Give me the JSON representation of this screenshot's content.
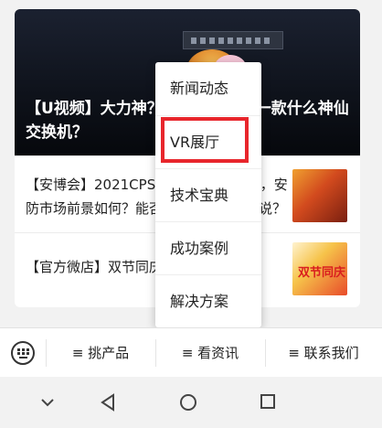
{
  "hero": {
    "title": "【U视频】大力神？小黄鸭？这是一款什么神仙交换机？"
  },
  "news": [
    {
      "text": "【安博会】2021CPSE安博会重磅开展，安防市场前景如何？能否迎来新机遇呢？说？",
      "thumb_icon": "expo-photo"
    },
    {
      "text": "【官方微店】双节同庆",
      "thumb_icon": "promo-banner",
      "thumb_text": "双节同庆"
    }
  ],
  "dropdown": {
    "items": [
      "新闻动态",
      "VR展厅",
      "技术宝典",
      "成功案例",
      "解决方案"
    ],
    "highlighted": "VR展厅",
    "highlight_color": "#e8262c"
  },
  "bottom_menu": {
    "keyboard_icon": "keyboard-icon",
    "buttons": [
      "≡ 挑产品",
      "≡ 看资讯",
      "≡ 联系我们"
    ]
  },
  "system_nav": {
    "icons": [
      "chevron-down-icon",
      "back-triangle-icon",
      "home-circle-icon",
      "recents-square-icon"
    ]
  },
  "colors": {
    "accent": "#e8262c",
    "background": "#f2f2f2"
  }
}
